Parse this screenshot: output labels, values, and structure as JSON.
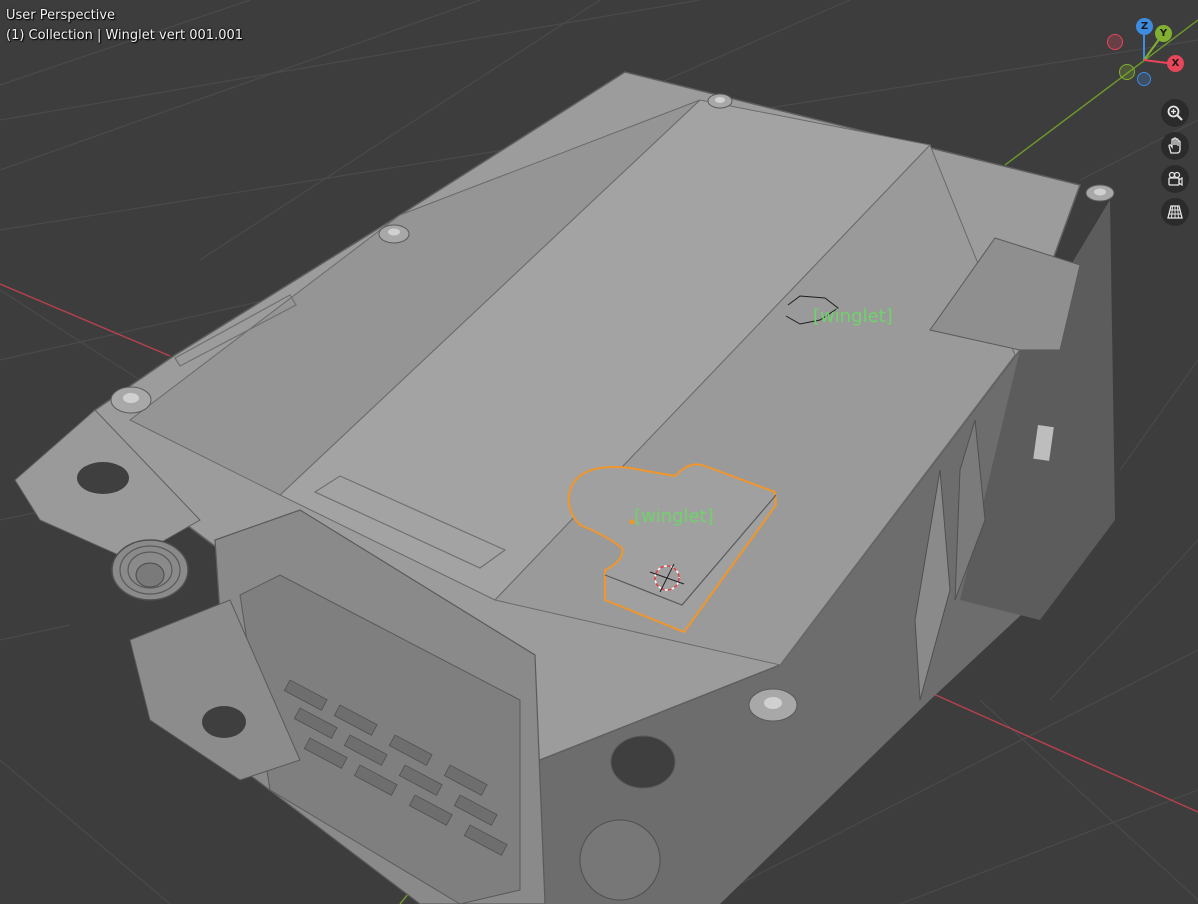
{
  "viewport": {
    "view_name": "User Perspective",
    "object_info": "(1) Collection | Winglet vert 001.001"
  },
  "labels": {
    "winglet_active": "[winglet]",
    "winglet_inactive": "[winglet]"
  },
  "gizmo": {
    "z_label": "Z",
    "y_label": "Y",
    "x_label": "X",
    "colors": {
      "x": "#e8465a",
      "y": "#82b030",
      "z": "#3e8ce0"
    }
  },
  "nav_buttons": [
    {
      "name": "zoom",
      "icon": "zoom-icon"
    },
    {
      "name": "pan",
      "icon": "hand-icon"
    },
    {
      "name": "camera",
      "icon": "camera-icon"
    },
    {
      "name": "ortho",
      "icon": "grid-icon"
    }
  ],
  "colors": {
    "background": "#3d3d3d",
    "grid": "#4a4a4a",
    "x_axis": "#b8414d",
    "y_axis": "#6f9b2c",
    "model": "#999999",
    "selection": "#f0962b",
    "label_green": "#6fd36a"
  }
}
